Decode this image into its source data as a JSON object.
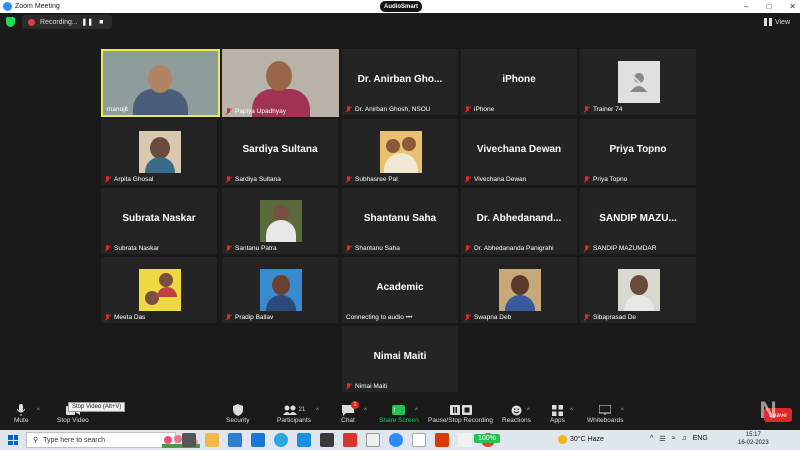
{
  "window": {
    "title": "Zoom Meeting",
    "center_logo": "AudioSmart"
  },
  "topbar": {
    "recording_label": "Recording...",
    "view_label": "View"
  },
  "tiles": [
    {
      "display_name": "",
      "label": "manojit",
      "kind": "video",
      "active": true
    },
    {
      "display_name": "",
      "label": "Papiya Upadhyay",
      "kind": "video"
    },
    {
      "display_name": "Dr. Anirban Gho...",
      "label": "Dr. Anirban Ghosh, NSOU",
      "kind": "name"
    },
    {
      "display_name": "iPhone",
      "label": "iPhone",
      "kind": "name"
    },
    {
      "display_name": "",
      "label": "Trainer 74",
      "kind": "placeholder"
    },
    {
      "display_name": "",
      "label": "Arpita Ghosal",
      "kind": "photo"
    },
    {
      "display_name": "Sardiya Sultana",
      "label": "Sardiya Sultana",
      "kind": "name"
    },
    {
      "display_name": "",
      "label": "Subhasree Pal",
      "kind": "photo"
    },
    {
      "display_name": "Vivechana Dewan",
      "label": "Vivechana Dewan",
      "kind": "name"
    },
    {
      "display_name": "Priya Topno",
      "label": "Priya Topno",
      "kind": "name"
    },
    {
      "display_name": "Subrata Naskar",
      "label": "Subrata Naskar",
      "kind": "name"
    },
    {
      "display_name": "",
      "label": "Santanu Patra",
      "kind": "photo"
    },
    {
      "display_name": "Shantanu Saha",
      "label": "Shantanu Saha",
      "kind": "name"
    },
    {
      "display_name": "Dr. Abhedanand...",
      "label": "Dr. Abhedananda Panigrahi",
      "kind": "name"
    },
    {
      "display_name": "SANDIP MAZU...",
      "label": "SANDIP MAZUMDAR",
      "kind": "name"
    },
    {
      "display_name": "",
      "label": "Meeta Das",
      "kind": "photo"
    },
    {
      "display_name": "",
      "label": "Pradip Ballav",
      "kind": "photo"
    },
    {
      "display_name": "Academic",
      "label": "Connecting to audio •••",
      "kind": "name",
      "no_mic": true
    },
    {
      "display_name": "",
      "label": "Swapna Deb",
      "kind": "photo"
    },
    {
      "display_name": "",
      "label": "Sibaprasad De",
      "kind": "photo"
    },
    {
      "display_name": "Nimai Maiti",
      "label": "Nimai Maiti",
      "kind": "name"
    }
  ],
  "toolbar": {
    "mute": "Mute",
    "stop_video": "Stop Video",
    "tooltip": "Stop Video (Alt+V)",
    "security": "Security",
    "participants": "Participants",
    "participants_count": "21",
    "chat": "Chat",
    "chat_badge": "1",
    "share_screen": "Share Screen",
    "pause_recording": "Pause/Stop Recording",
    "reactions": "Reactions",
    "apps": "Apps",
    "whiteboards": "Whiteboards",
    "leave": "Leave"
  },
  "taskbar": {
    "search_placeholder": "Type here to search",
    "zoom_level": "100%",
    "weather": "30°C  Haze",
    "language": "ENG",
    "time": "15:17",
    "date": "16-02-2023"
  },
  "colors": {
    "active_border": "#e8f046",
    "share_green": "#23c552",
    "leave_red": "#e02828",
    "tile_bg": "#242424"
  }
}
